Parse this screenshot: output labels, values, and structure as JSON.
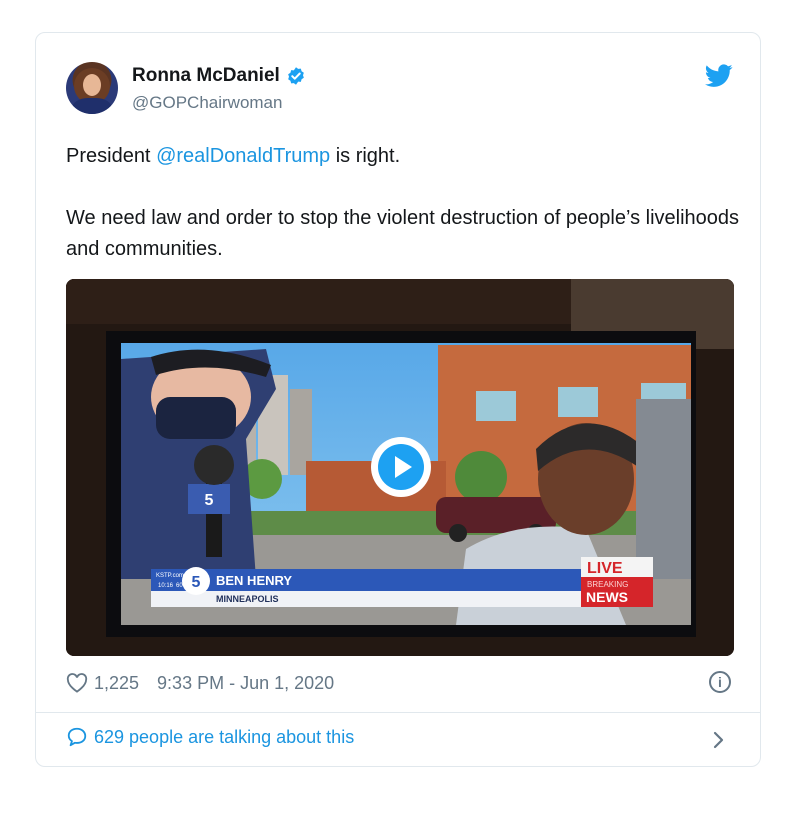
{
  "author": {
    "name": "Ronna McDaniel",
    "handle": "@GOPChairwoman",
    "verified": true
  },
  "tweet": {
    "line1_prefix": "President ",
    "mention": "@realDonaldTrump",
    "line1_suffix": " is right.",
    "line2": "We need law and order to stop the violent destruction of people’s livelihoods and communities."
  },
  "video": {
    "lower_third_name": "BEN HENRY",
    "lower_third_location": "MINNEAPOLIS",
    "station_time": "10:16",
    "station_temp": "60°",
    "station_site": "KSTP.com",
    "badge_live": "LIVE",
    "badge_breaking": "BREAKING",
    "badge_news": "NEWS",
    "mic_flag": "5"
  },
  "footer": {
    "likes": "1,225",
    "timestamp": "9:33 PM - Jun 1, 2020",
    "talking": "629 people are talking about this"
  },
  "icons": {
    "verified": "verified-badge-icon",
    "bird": "twitter-bird-icon",
    "heart": "heart-icon",
    "info": "info-icon",
    "reply": "reply-bubble-icon",
    "chevron": "chevron-right-icon",
    "play": "play-icon"
  },
  "colors": {
    "accent": "#1da1f2",
    "link": "#1b95e0",
    "muted": "#657786",
    "border": "#e1e8ed"
  }
}
